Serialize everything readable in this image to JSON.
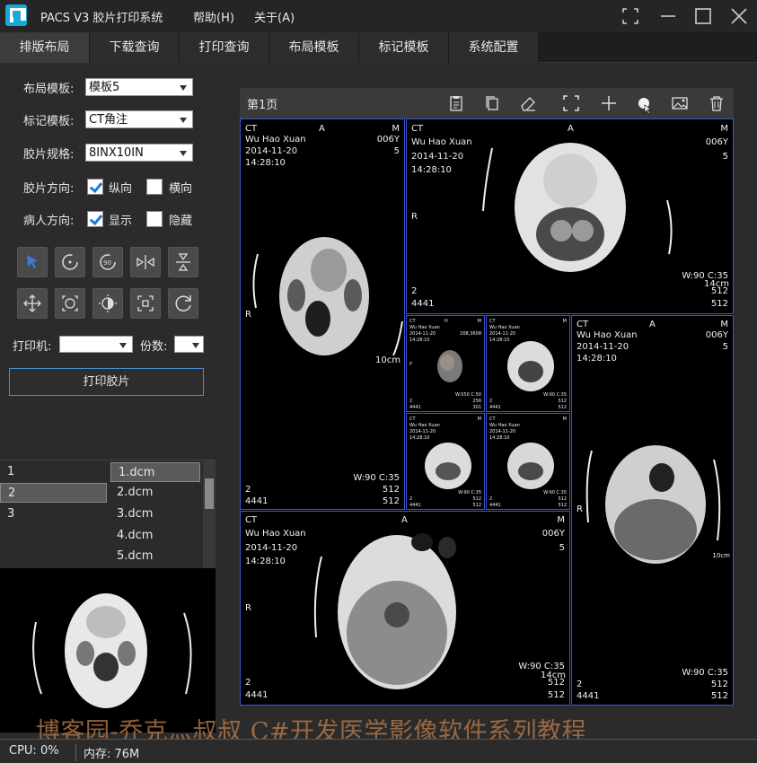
{
  "window": {
    "title": "PACS V3 胶片打印系统",
    "menu": [
      "帮助(H)",
      "关于(A)"
    ]
  },
  "tabs": [
    "排版布局",
    "下载查询",
    "打印查询",
    "布局模板",
    "标记模板",
    "系统配置"
  ],
  "form": {
    "layout_template_label": "布局模板:",
    "layout_template_value": "模板5",
    "mark_template_label": "标记模板:",
    "mark_template_value": "CT角注",
    "film_size_label": "胶片规格:",
    "film_size_value": "8INX10IN",
    "film_orientation_label": "胶片方向:",
    "orientation_portrait": "纵向",
    "orientation_landscape": "横向",
    "patient_orientation_label": "病人方向:",
    "show_label": "显示",
    "hide_label": "隐藏",
    "printer_label": "打印机:",
    "copies_label": "份数:",
    "print_button": "打印胶片"
  },
  "series_list": [
    "1",
    "2",
    "3"
  ],
  "file_list": [
    "1.dcm",
    "2.dcm",
    "3.dcm",
    "4.dcm",
    "5.dcm"
  ],
  "film": {
    "page_title": "第1页"
  },
  "dicom": {
    "modality": "CT",
    "orient_a": "A",
    "orient_m": "M",
    "orient_r": "R",
    "orient_p": "P",
    "orient_h": "H",
    "patient": "Wu Hao Xuan",
    "date": "2014-11-20",
    "time": "14:28:10",
    "age": "006Y",
    "image_no": "5",
    "series_no": "2",
    "study_no": "4441",
    "window": "W:90 C:35",
    "matrix": "512",
    "scale_10": "10cm",
    "scale_14": "14cm",
    "small_size": "208,3608",
    "small_window": "W:550 C:50",
    "small_matrix": "256",
    "small_image": "301"
  },
  "status": {
    "cpu": "CPU:  0%",
    "memory": "内存:  76M"
  },
  "watermark": "博客园-乔克灬叔叔 C#开发医学影像软件系列教程"
}
